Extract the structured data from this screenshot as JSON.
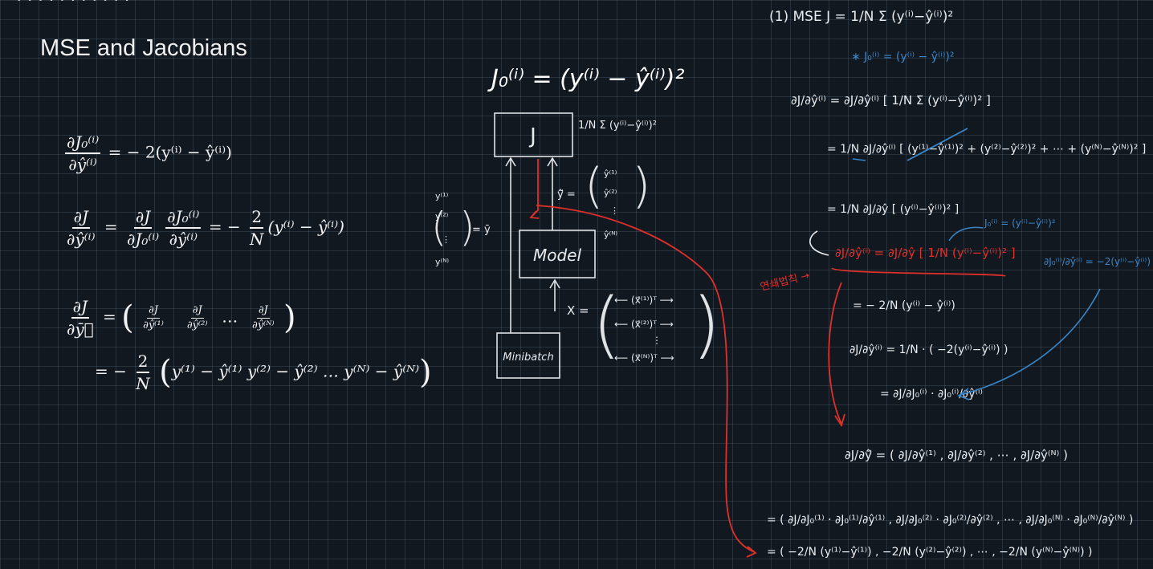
{
  "header_fragment": "· · · · · · · · · · ·",
  "title": "MSE and Jacobians",
  "colors": {
    "background": "#111820",
    "grid": "#3a4652",
    "chalk": "#f2f2f2",
    "red": "#e0302a",
    "blue": "#3a86c8"
  },
  "left_equations": {
    "eq1": {
      "num": "∂J₀⁽ⁱ⁾",
      "den": "∂ŷ⁽ⁱ⁾",
      "rhs": "= − 2(y⁽ⁱ⁾ − ŷ⁽ⁱ⁾)"
    },
    "eq2": {
      "lhs_num": "∂J",
      "lhs_den": "∂ŷ⁽ⁱ⁾",
      "mid1_num": "∂J",
      "mid1_den": "∂J₀⁽ⁱ⁾",
      "mid2_num": "∂J₀⁽ⁱ⁾",
      "mid2_den": "∂ŷ⁽ⁱ⁾",
      "coef_num": "2",
      "coef_den": "N",
      "rhs": "(y⁽ⁱ⁾ − ŷ⁽ⁱ⁾)"
    },
    "eq3": {
      "lhs_num": "∂J",
      "lhs_den": "∂ȳ⃗",
      "e1_num": "∂J",
      "e1_den": "∂ŷ⁽¹⁾",
      "e2_num": "∂J",
      "e2_den": "∂ŷ⁽²⁾",
      "dots": "…",
      "eN_num": "∂J",
      "eN_den": "∂ŷ⁽ᴺ⁾"
    },
    "eq4": {
      "coef_num": "2",
      "coef_den": "N",
      "body": "y⁽¹⁾ − ŷ⁽¹⁾   y⁽²⁾ − ŷ⁽²⁾   …   y⁽ᴺ⁾ − ŷ⁽ᴺ⁾"
    }
  },
  "diagram": {
    "heading": "J₀⁽ⁱ⁾ = (y⁽ⁱ⁾ − ŷ⁽ⁱ⁾)²",
    "J_box": "J",
    "J_formula": "1/N Σ (y⁽ⁱ⁾−ŷ⁽ⁱ⁾)²",
    "model_box": "Model",
    "minibatch_box": "Minibatch",
    "y_vec": [
      "y⁽¹⁾",
      "y⁽²⁾",
      "⋮",
      "y⁽ᴺ⁾"
    ],
    "y_label": "= ȳ",
    "yhat_label": "ŷ⃗ =",
    "yhat_vec": [
      "ŷ⁽¹⁾",
      "ŷ⁽²⁾",
      "⋮",
      "ŷ⁽ᴺ⁾"
    ],
    "X_label": "X =",
    "X_rows": [
      "⟵ (x⃗⁽¹⁾)ᵀ ⟶",
      "⟵ (x⃗⁽²⁾)ᵀ ⟶",
      "⋮",
      "⟵ (x⃗⁽ᴺ⁾)ᵀ ⟶"
    ]
  },
  "notes": {
    "n1": "(1) MSE     J = 1/N Σ (y⁽ⁱ⁾−ŷ⁽ⁱ⁾)²",
    "n2": "∗ J₀⁽ⁱ⁾ = (y⁽ⁱ⁾ − ŷ⁽ⁱ⁾)²",
    "n3": "∂J/∂ŷ⁽ⁱ⁾  =  ∂J/∂ŷ⁽ⁱ⁾ [ 1/N Σ (y⁽ⁱ⁾−ŷ⁽ⁱ⁾)² ]",
    "n4": "= 1/N ∂J/∂ŷ⁽ⁱ⁾ [ (y⁽¹⁾−ŷ⁽¹⁾)² + (y⁽²⁾−ŷ⁽²⁾)² + ⋯ + (y⁽ᴺ⁾−ŷ⁽ᴺ⁾)² ]",
    "n5": "= 1/N ∂J/∂ŷ [ (y⁽ⁱ⁾−ŷ⁽ⁱ⁾)² ]",
    "n6_red": "∂J/∂ŷ⁽ⁱ⁾ = ∂J/∂ŷ [ 1/N (y⁽ⁱ⁾−ŷ⁽ⁱ⁾)² ]",
    "n6_blue1": "J₀⁽ⁱ⁾ = (y⁽ⁱ⁾−ŷ⁽ⁱ⁾)²",
    "n6_blue2": "∂J₀⁽ⁱ⁾/∂ŷ⁽ⁱ⁾ = −2(y⁽ⁱ⁾−ŷ⁽ⁱ⁾)",
    "side_red": "연쇄법칙 →",
    "n7": "= − 2/N (y⁽ⁱ⁾ − ŷ⁽ⁱ⁾)",
    "n8": "∂J/∂ŷ⁽ⁱ⁾ = 1/N · ( −2(y⁽ⁱ⁾−ŷ⁽ⁱ⁾) )",
    "n9": "= ∂J/∂J₀⁽ⁱ⁾ · ∂J₀⁽ⁱ⁾/∂ŷ⁽ⁱ⁾",
    "n10": "∂J/∂ŷ⃗ = ( ∂J/∂ŷ⁽¹⁾ ,  ∂J/∂ŷ⁽²⁾ ,  ⋯ ,  ∂J/∂ŷ⁽ᴺ⁾ )",
    "n11": "= ( ∂J/∂J₀⁽¹⁾ · ∂J₀⁽¹⁾/∂ŷ⁽¹⁾ ,  ∂J/∂J₀⁽²⁾ · ∂J₀⁽²⁾/∂ŷ⁽²⁾ ,  ⋯ ,  ∂J/∂J₀⁽ᴺ⁾ · ∂J₀⁽ᴺ⁾/∂ŷ⁽ᴺ⁾ )",
    "n12": "= ( −2/N (y⁽¹⁾−ŷ⁽¹⁾) ,  −2/N (y⁽²⁾−ŷ⁽²⁾) ,  ⋯ ,  −2/N (y⁽ᴺ⁾−ŷ⁽ᴺ⁾) )"
  }
}
